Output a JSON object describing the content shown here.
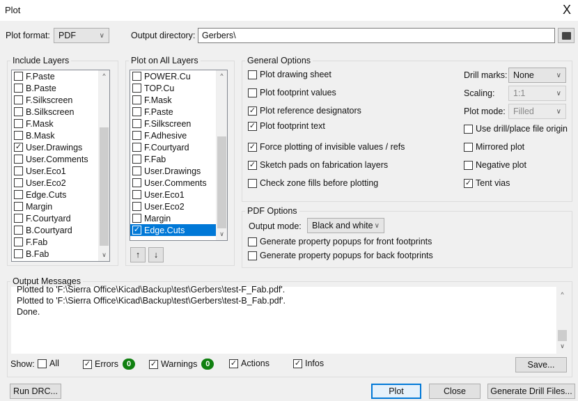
{
  "window": {
    "title": "Plot",
    "close": "X"
  },
  "top": {
    "plot_format_label": "Plot format:",
    "plot_format": "PDF",
    "output_dir_label": "Output directory:",
    "output_dir": "Gerbers\\",
    "folder_icon": "folder-icon"
  },
  "include_layers": {
    "title": "Include Layers",
    "items": [
      {
        "label": "F.Paste",
        "checked": false
      },
      {
        "label": "B.Paste",
        "checked": false
      },
      {
        "label": "F.Silkscreen",
        "checked": false
      },
      {
        "label": "B.Silkscreen",
        "checked": false
      },
      {
        "label": "F.Mask",
        "checked": false
      },
      {
        "label": "B.Mask",
        "checked": false
      },
      {
        "label": "User.Drawings",
        "checked": true
      },
      {
        "label": "User.Comments",
        "checked": false
      },
      {
        "label": "User.Eco1",
        "checked": false
      },
      {
        "label": "User.Eco2",
        "checked": false
      },
      {
        "label": "Edge.Cuts",
        "checked": false
      },
      {
        "label": "Margin",
        "checked": false
      },
      {
        "label": "F.Courtyard",
        "checked": false
      },
      {
        "label": "B.Courtyard",
        "checked": false
      },
      {
        "label": "F.Fab",
        "checked": false
      },
      {
        "label": "B.Fab",
        "checked": false
      }
    ]
  },
  "plot_all_layers": {
    "title": "Plot on All Layers",
    "items": [
      {
        "label": "POWER.Cu",
        "checked": false
      },
      {
        "label": "TOP.Cu",
        "checked": false
      },
      {
        "label": "F.Mask",
        "checked": false
      },
      {
        "label": "F.Paste",
        "checked": false
      },
      {
        "label": "F.Silkscreen",
        "checked": false
      },
      {
        "label": "F.Adhesive",
        "checked": false
      },
      {
        "label": "F.Courtyard",
        "checked": false
      },
      {
        "label": "F.Fab",
        "checked": false
      },
      {
        "label": "User.Drawings",
        "checked": false
      },
      {
        "label": "User.Comments",
        "checked": false
      },
      {
        "label": "User.Eco1",
        "checked": false
      },
      {
        "label": "User.Eco2",
        "checked": false
      },
      {
        "label": "Margin",
        "checked": false
      },
      {
        "label": "Edge.Cuts",
        "checked": true,
        "selected": true
      }
    ],
    "up": "↑",
    "down": "↓"
  },
  "general": {
    "title": "General Options",
    "left": [
      {
        "label": "Plot drawing sheet",
        "checked": false
      },
      {
        "label": "Plot footprint values",
        "checked": false
      },
      {
        "label": "Plot reference designators",
        "checked": true
      },
      {
        "label": "Plot footprint text",
        "checked": true
      },
      {
        "label": "Force plotting of invisible values / refs",
        "checked": true
      },
      {
        "label": "Sketch pads on fabrication layers",
        "checked": true
      },
      {
        "label": "Check zone fills before plotting",
        "checked": false
      }
    ],
    "drill_marks_label": "Drill marks:",
    "drill_marks": "None",
    "scaling_label": "Scaling:",
    "scaling": "1:1",
    "plot_mode_label": "Plot mode:",
    "plot_mode": "Filled",
    "right": [
      {
        "label": "Use drill/place file origin",
        "checked": false
      },
      {
        "label": "Mirrored plot",
        "checked": false
      },
      {
        "label": "Negative plot",
        "checked": false
      },
      {
        "label": "Tent vias",
        "checked": true
      }
    ]
  },
  "pdf": {
    "title": "PDF Options",
    "output_mode_label": "Output mode:",
    "output_mode": "Black and white",
    "options": [
      {
        "label": "Generate property popups for front footprints",
        "checked": false
      },
      {
        "label": "Generate property popups for back footprints",
        "checked": false
      }
    ]
  },
  "messages": {
    "title": "Output Messages",
    "lines": [
      "Plotted to 'F:\\Sierra Office\\Kicad\\Backup\\test\\Gerbers\\test-F_Fab.pdf'.",
      "Plotted to 'F:\\Sierra Office\\Kicad\\Backup\\test\\Gerbers\\test-B_Fab.pdf'.",
      "Done."
    ],
    "show_label": "Show:",
    "filters": [
      {
        "label": "All",
        "checked": false
      },
      {
        "label": "Errors",
        "checked": true,
        "count": "0"
      },
      {
        "label": "Warnings",
        "checked": true,
        "count": "0"
      },
      {
        "label": "Actions",
        "checked": true
      },
      {
        "label": "Infos",
        "checked": true
      }
    ],
    "save": "Save..."
  },
  "buttons": {
    "run_drc": "Run DRC...",
    "plot": "Plot",
    "close": "Close",
    "drill": "Generate Drill Files..."
  },
  "colors": {
    "accent": "#0078d7",
    "badge": "#108010"
  }
}
